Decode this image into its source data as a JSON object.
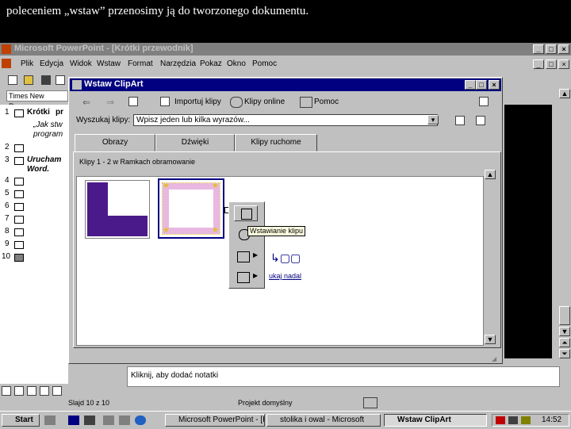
{
  "caption": "poleceniem „wstaw” przenosimy ją do tworzonego dokumentu.",
  "app": {
    "title": "Microsoft PowerPoint - [Krótki przewodnik]"
  },
  "menu": [
    "Plik",
    "Edycja",
    "Widok",
    "Wstaw",
    "Format",
    "Narzędzia",
    "Pokaz",
    "Okno",
    "Pomoc"
  ],
  "font_box": "Times New Roman",
  "outline": {
    "slide_numbers": [
      "1",
      "2",
      "3",
      "4",
      "5",
      "6",
      "7",
      "8",
      "9",
      "10"
    ],
    "slide1_title": "Krótki",
    "slide1_line1": "pr",
    "slide1_line2": "„Jak stw",
    "slide1_line3": "program",
    "slide3_line1": "Urucham",
    "slide3_line2": "Word."
  },
  "dialog": {
    "title": "Wstaw ClipArt",
    "toolbar": {
      "import_label": "Importuj klipy",
      "online_label": "Klipy online",
      "help_label": "Pomoc"
    },
    "search_label": "Wyszukaj klipy:",
    "search_value": "Wpisz jeden lub kilka wyrazów...",
    "tabs": [
      "Obrazy",
      "Dźwięki",
      "Klipy ruchome"
    ],
    "clips_info": "Klipy 1 - 2 w Ramkach obramowanie",
    "popup_tooltip": "Wstawianie klipu",
    "popup_extra": "ukaj nadal"
  },
  "notes_placeholder": "Kliknij, aby dodać notatki",
  "status": {
    "slide": "Slajd 10 z 10",
    "design": "Projekt domyślny"
  },
  "taskbar": {
    "start": "Start",
    "items": [
      "Microsoft PowerPoint - [K",
      "stolika i owal - Microsoft",
      "Wstaw ClipArt"
    ],
    "clock": "14:52"
  },
  "colors": {
    "title_active": "#000080",
    "title_inactive": "#808080",
    "face": "#c0c0c0",
    "clip_purple": "#4b1a8a"
  }
}
